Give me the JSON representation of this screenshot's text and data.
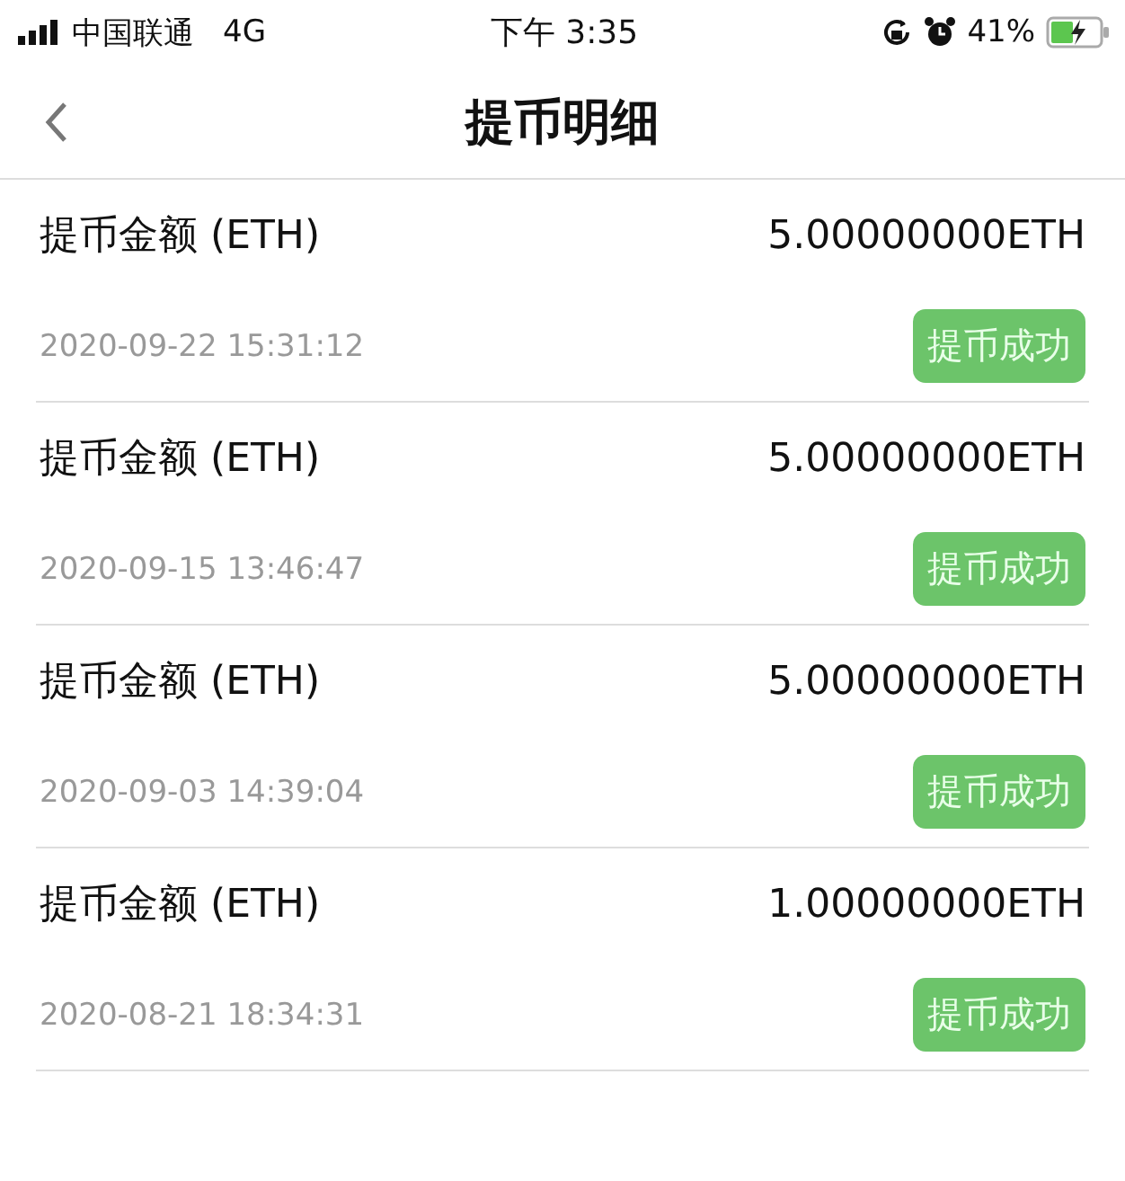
{
  "status_bar": {
    "carrier": "中国联通",
    "network": "4G",
    "time": "下午 3:35",
    "battery": "41%"
  },
  "nav": {
    "title": "提币明细"
  },
  "records": [
    {
      "label": "提币金额 (ETH)",
      "amount": "5.00000000ETH",
      "date": "2020-09-22 15:31:12",
      "status": "提币成功"
    },
    {
      "label": "提币金额 (ETH)",
      "amount": "5.00000000ETH",
      "date": "2020-09-15 13:46:47",
      "status": "提币成功"
    },
    {
      "label": "提币金额 (ETH)",
      "amount": "5.00000000ETH",
      "date": "2020-09-03 14:39:04",
      "status": "提币成功"
    },
    {
      "label": "提币金额 (ETH)",
      "amount": "1.00000000ETH",
      "date": "2020-08-21 18:34:31",
      "status": "提币成功"
    }
  ]
}
